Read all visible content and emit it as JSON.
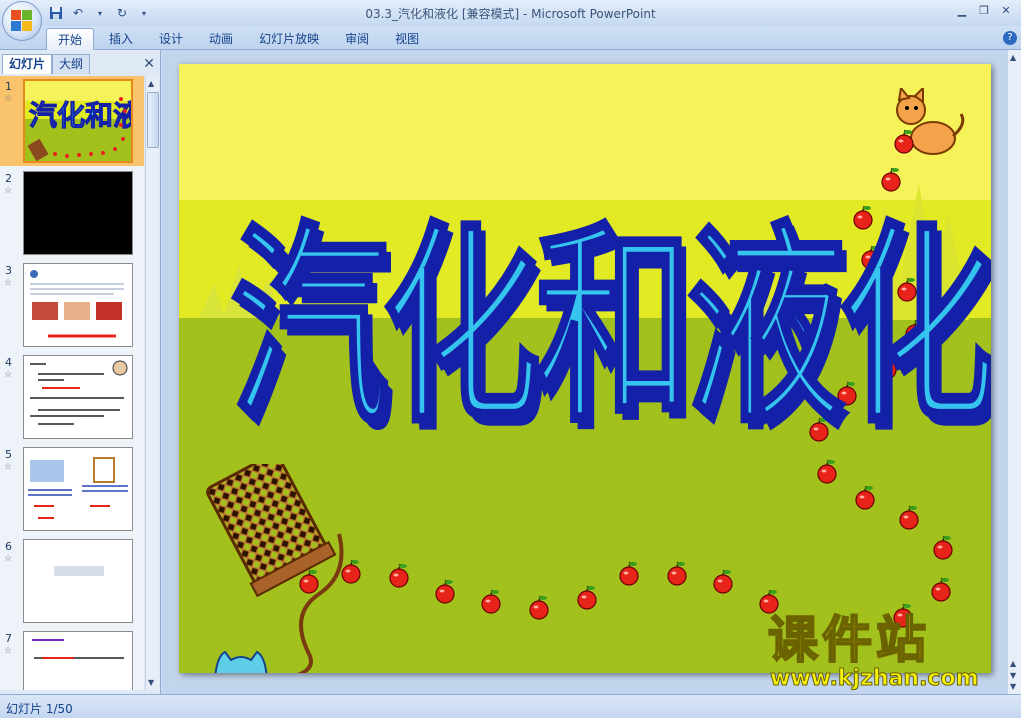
{
  "window": {
    "title": "03.3_汽化和液化 [兼容模式] - Microsoft PowerPoint"
  },
  "ribbon": {
    "tabs": [
      {
        "label": "开始",
        "active": true
      },
      {
        "label": "插入"
      },
      {
        "label": "设计"
      },
      {
        "label": "动画"
      },
      {
        "label": "幻灯片放映"
      },
      {
        "label": "审阅"
      },
      {
        "label": "视图"
      }
    ]
  },
  "left_pane": {
    "tab_slides": "幻灯片",
    "tab_outline": "大纲",
    "thumbnails": [
      {
        "num": "1",
        "star": "☆"
      },
      {
        "num": "2",
        "star": "☆"
      },
      {
        "num": "3",
        "star": "☆"
      },
      {
        "num": "4",
        "star": "☆"
      },
      {
        "num": "5",
        "star": "☆"
      },
      {
        "num": "6",
        "star": "☆"
      },
      {
        "num": "7",
        "star": "☆"
      }
    ]
  },
  "slide": {
    "title": "汽化和液化"
  },
  "status": {
    "slide_counter": "幻灯片 1/50"
  },
  "watermark": {
    "cn": "课件站",
    "url": "www.kjzhan.com"
  },
  "colors": {
    "slide_sky": "#f5f25a",
    "slide_band": "#e2ea24",
    "slide_grass": "#a2c11d",
    "title_fill": "#35c4ee",
    "title_shadow": "#1420a8",
    "apple": "#e8231a"
  }
}
